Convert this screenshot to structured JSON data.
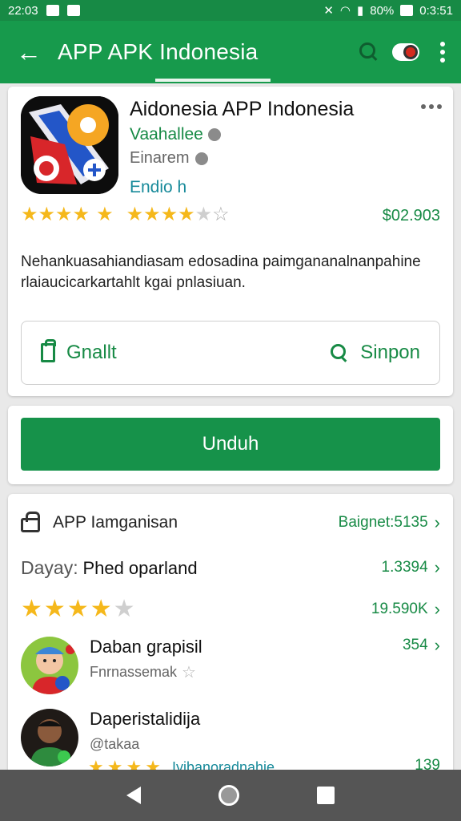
{
  "status_bar": {
    "time": "22:03",
    "battery": "80%",
    "clock_right": "0:3:51"
  },
  "app_bar": {
    "title": "APP APK Indonesia",
    "icons": [
      "back-arrow-icon",
      "search-icon",
      "avatar-icon",
      "overflow-menu-icon"
    ]
  },
  "app": {
    "name": "Aidonesia APP Indonesia",
    "developer": "Vaahallee",
    "category": "Einarem",
    "badge": "Endio h",
    "rating_stars": 5,
    "rating_secondary": 3.5,
    "price": "$02.903",
    "description": "Nehankuasahiandiasam edosadina paimgananalnanpahine rlaiaucicarkartahlt kgai pnlasiuan.",
    "actions": {
      "wishlist_label": "Gnallt",
      "search_label": "Sinpon"
    }
  },
  "download": {
    "label": "Unduh"
  },
  "details": {
    "rows": [
      {
        "label": "APP Iamganisan",
        "value": "Baignet:5135"
      },
      {
        "lead": "Dayay:",
        "label": "Phed oparland",
        "value": "1.3394"
      },
      {
        "stars": 4,
        "value": "19.590K"
      }
    ],
    "reviews": [
      {
        "name": "Daban grapisil",
        "sub": "Fnrnassemak",
        "count": "354"
      },
      {
        "name": "Daperistalidija",
        "sub": "@takaa",
        "count": "139",
        "note": "Iyibanoradnahie"
      }
    ]
  },
  "colors": {
    "brand_green": "#179a4c",
    "star_yellow": "#f5b81b",
    "teal": "#178a9a"
  }
}
